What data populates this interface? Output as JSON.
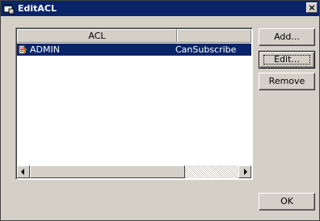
{
  "window": {
    "title": "EditACL",
    "close_glyph": "×"
  },
  "list": {
    "columns": [
      "ACL",
      ""
    ],
    "rows": [
      {
        "acl": "ADMIN",
        "permission": "CanSubscribe",
        "icon": "user-edit-icon",
        "selected": true
      }
    ]
  },
  "buttons": {
    "add": "Add...",
    "edit": "Edit...",
    "remove": "Remove",
    "ok": "OK"
  },
  "colors": {
    "selection": "#0a246a",
    "titlebar": "#0a246a",
    "face": "#d4d0c8"
  }
}
